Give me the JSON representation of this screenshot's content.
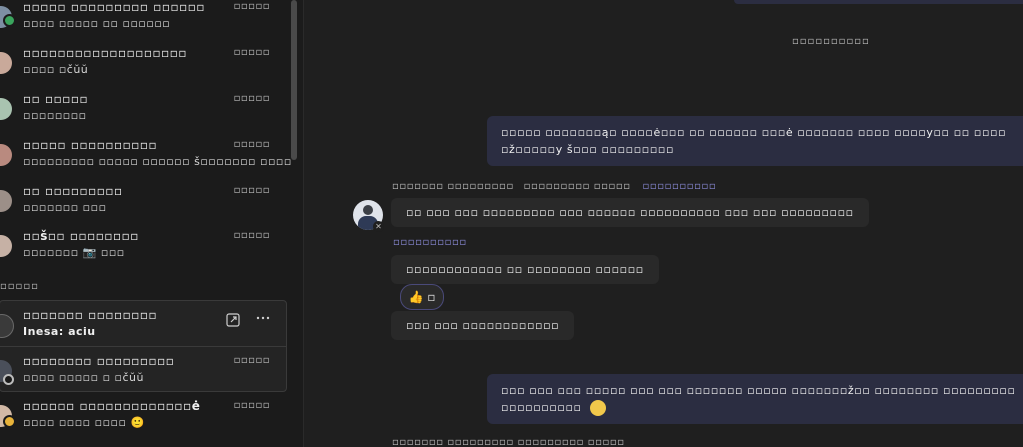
{
  "sidebar": {
    "chats": [
      {
        "name": "▫▫▫▫▫ ▫▫▫▫▫▫▫▫▫ ▫▫▫▫▫▫",
        "preview": "▫▫▫▫ ▫▫▫▫▫ ▫▫ ▫▫▫▫▫▫",
        "time": "▫▫▫▫▫",
        "status_color": "#3aa55d"
      },
      {
        "name": "▫▫▫▫▫▫▫▫▫▫▫▫▫▫▫▫▫▫▫",
        "preview": "▫▫▫▫ ▫čŭŭ",
        "time": "▫▫▫▫▫",
        "status_color": ""
      },
      {
        "name": "▫▫ ▫▫▫▫▫",
        "preview": "▫▫▫▫▫▫▫▫",
        "time": "▫▫▫▫▫",
        "status_color": ""
      },
      {
        "name": "▫▫▫▫▫ ▫▫▫▫▫▫▫▫▫▫",
        "preview": "▫▫▫▫▫▫▫▫▫ ▫▫▫▫▫ ▫▫▫▫▫▫ š▫▫▫▫▫▫▫ ▫▫▫▫",
        "time": "▫▫▫▫▫",
        "status_color": ""
      },
      {
        "name": "▫▫ ▫▫▫▫▫▫▫▫▫",
        "preview": "▫▫▫▫▫▫▫ ▫▫▫",
        "time": "▫▫▫▫▫",
        "status_color": ""
      },
      {
        "name": "▫▫š▫▫ ▫▫▫▫▫▫▫▫",
        "preview": "▫▫▫▫▫▫▫ 📷 ▫▫▫",
        "time": "▫▫▫▫▫",
        "status_color": ""
      }
    ],
    "section_title": "▫▫▫▫▫",
    "selected_chat": {
      "name": "▫▫▫▫▫▫▫ ▫▫▫▫▫▫▫▫",
      "preview": "Inesa: aciu"
    },
    "chats_after": [
      {
        "name": "▫▫▫▫▫▫▫▫ ▫▫▫▫▫▫▫▫▫",
        "preview": "▫▫▫▫ ▫▫▫▫▫ ▫ ▫čŭŭ",
        "time": "▫▫▫▫▫",
        "status_color": ""
      },
      {
        "name": "▫▫▫▫▫▫ ▫▫▫▫▫▫▫▫▫▫▫▫▫ė",
        "preview": "▫▫▫▫ ▫▫▫▫ ▫▫▫▫ 🙂",
        "time": "▫▫▫▫▫",
        "status_color": "#e8b33a"
      }
    ],
    "actions": {
      "popout_icon": "popout-icon",
      "more_icon": "more-icon"
    }
  },
  "main": {
    "date_separator": "▫▫▫▫▫▫▫▫▫▫",
    "outgoing_1": {
      "line1": "▫▫▫▫▫ ▫▫▫▫▫▫▫ą▫ ▫▫▫▫ė▫▫▫ ▫▫ ▫▫▫▫▫▫ ▫▫▫ė ▫▫▫▫▫▫▫ ▫▫▫▫ ▫▫▫▫y▫▫ ▫▫ ▫▫▫▫",
      "line2": "▫ž▫▫▫▫▫y š▫▫▫ ▫▫▫▫▫▫▫▫▫"
    },
    "incoming_meta": {
      "sender": "▫▫▫▫▫▫▫ ▫▫▫▫▫▫▫▫▫",
      "time": "▫▫▫▫▫▫▫▫▫ ▫▫▫▫▫",
      "edited": "▫▫▫▫▫▫▫▫▫▫"
    },
    "incoming_1": "▫▫ ▫▫▫ ▫▫▫ ▫▫▫▫▫▫▫▫▫ ▫▫▫ ▫▫▫▫▫▫ ▫▫▫▫▫▫▫▫▫▫ ▫▫▫ ▫▫▫ ▫▫▫▫▫▫▫▫▫",
    "incoming_link": "▫▫▫▫▫▫▫▫▫▫",
    "incoming_2": "▫▫▫▫▫▫▫▫▫▫▫▫ ▫▫ ▫▫▫▫▫▫▫▫ ▫▫▫▫▫▫",
    "reaction": {
      "icon": "thumbs-up-icon",
      "glyph": "👍",
      "count": "▫"
    },
    "incoming_3": "▫▫▫ ▫▫▫ ▫▫▫▫▫▫▫▫▫▫▫▫",
    "outgoing_2": {
      "line1": "▫▫▫ ▫▫▫ ▫▫▫ ▫▫▫▫▫ ▫▫▫ ▫▫▫ ▫▫▫▫▫▫▫ ▫▫▫▫▫ ▫▫▫▫▫▫▫ž▫▫ ▫▫▫▫▫▫▫▫ ▫▫▫▫▫▫▫▫▫",
      "line2": "▫▫▫▫▫▫▫▫▫▫"
    },
    "bottom_meta": "▫▫▫▫▫▫▫ ▫▫▫▫▫▫▫▫▫  ▫▫▫▫▫▫▫▫▫ ▫▫▫▫▫"
  },
  "colors": {
    "accent": "#8b8bd9",
    "outgoing_bubble": "#2b2d41",
    "incoming_bubble": "#292929"
  }
}
